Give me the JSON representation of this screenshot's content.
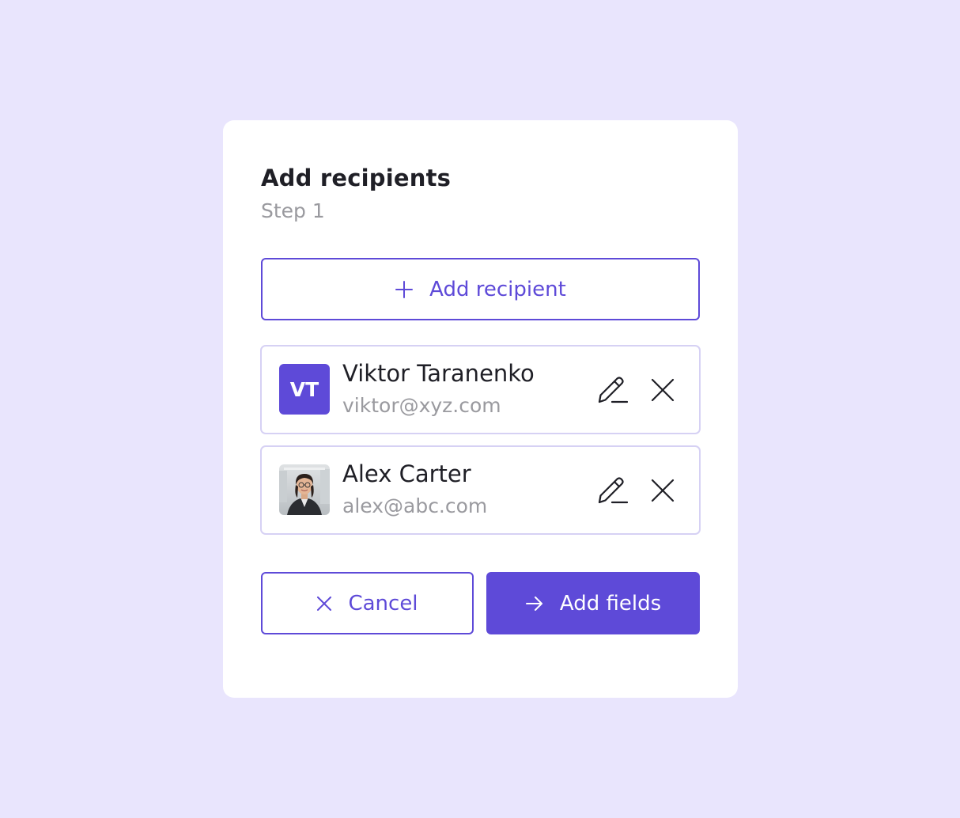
{
  "dialog": {
    "title": "Add recipients",
    "subtitle": "Step 1",
    "add_recipient_label": "Add recipient",
    "add_recipient_icon": "plus-icon"
  },
  "recipients": [
    {
      "name": "Viktor Taranenko",
      "email": "viktor@xyz.com",
      "avatar_initials": "VT",
      "avatar_type": "initials",
      "edit_icon": "pencil-icon",
      "remove_icon": "close-icon"
    },
    {
      "name": "Alex Carter",
      "email": "alex@abc.com",
      "avatar_type": "photo",
      "edit_icon": "pencil-icon",
      "remove_icon": "close-icon"
    }
  ],
  "actions": {
    "cancel_label": "Cancel",
    "cancel_icon": "close-icon",
    "primary_label": "Add fields",
    "primary_icon": "arrow-right-icon"
  },
  "colors": {
    "background": "#e9e5fd",
    "accent": "#5e4ad8",
    "card": "#ffffff",
    "text_primary": "#1f1f26",
    "text_secondary": "#9a9a9f",
    "row_border": "#d6d1f4"
  }
}
